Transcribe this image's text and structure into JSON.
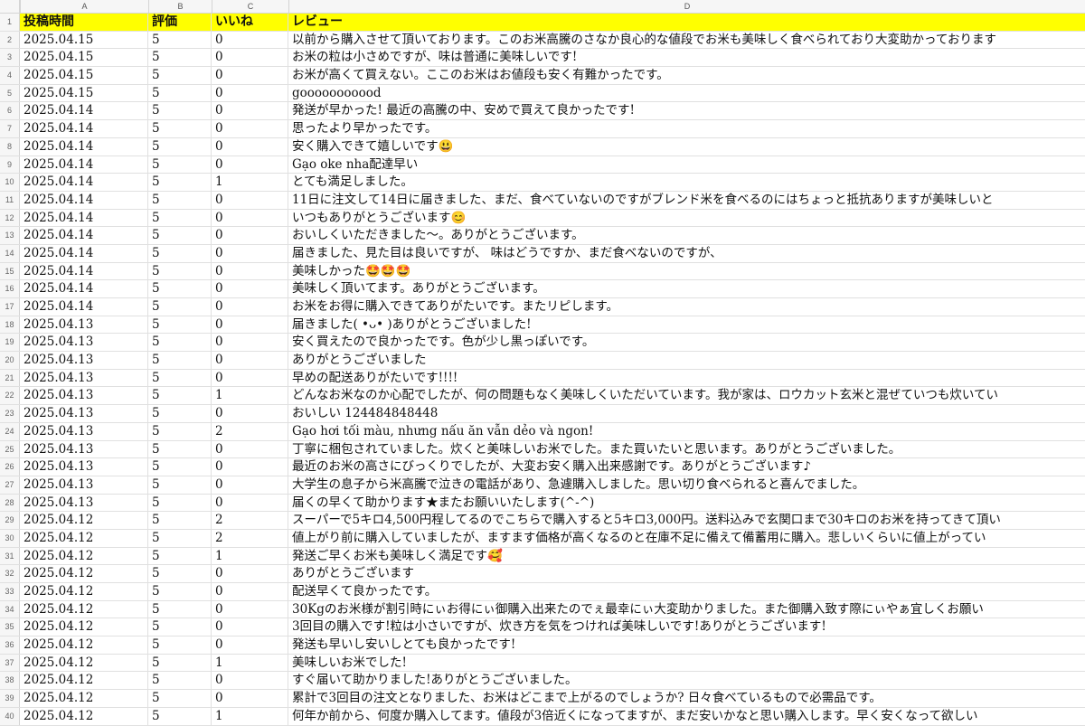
{
  "column_headers": [
    "A",
    "B",
    "C",
    "D"
  ],
  "header_row": {
    "row_num": "1",
    "a": "投稿時間",
    "b": "評価",
    "c": "いいね",
    "d": "レビュー"
  },
  "rows": [
    {
      "n": "2",
      "a": "2025.04.15",
      "b": "5",
      "c": "0",
      "d": "以前から購入させて頂いております。このお米高騰のさなか良心的な値段でお米も美味しく食べられており大変助かっております"
    },
    {
      "n": "3",
      "a": "2025.04.15",
      "b": "5",
      "c": "0",
      "d": "お米の粒は小さめですが、味は普通に美味しいです!"
    },
    {
      "n": "4",
      "a": "2025.04.15",
      "b": "5",
      "c": "0",
      "d": "お米が高くて買えない。ここのお米はお値段も安く有難かったです。"
    },
    {
      "n": "5",
      "a": "2025.04.15",
      "b": "5",
      "c": "0",
      "d": "gooooooooood"
    },
    {
      "n": "6",
      "a": "2025.04.14",
      "b": "5",
      "c": "0",
      "d": "発送が早かった! 最近の高騰の中、安めで買えて良かったです!"
    },
    {
      "n": "7",
      "a": "2025.04.14",
      "b": "5",
      "c": "0",
      "d": "思ったより早かったです。"
    },
    {
      "n": "8",
      "a": "2025.04.14",
      "b": "5",
      "c": "0",
      "d": "安く購入できて嬉しいです😃"
    },
    {
      "n": "9",
      "a": "2025.04.14",
      "b": "5",
      "c": "0",
      "d": "Gạo oke nha配達早い"
    },
    {
      "n": "10",
      "a": "2025.04.14",
      "b": "5",
      "c": "1",
      "d": "とても満足しました。"
    },
    {
      "n": "11",
      "a": "2025.04.14",
      "b": "5",
      "c": "0",
      "d": "11日に注文して14日に届きました、まだ、食べていないのですがブレンド米を食べるのにはちょっと抵抗ありますが美味しいと"
    },
    {
      "n": "12",
      "a": "2025.04.14",
      "b": "5",
      "c": "0",
      "d": "いつもありがとうございます😊"
    },
    {
      "n": "13",
      "a": "2025.04.14",
      "b": "5",
      "c": "0",
      "d": "おいしくいただきました〜。ありがとうございます。"
    },
    {
      "n": "14",
      "a": "2025.04.14",
      "b": "5",
      "c": "0",
      "d": "届きました、見た目は良いですが、 味はどうですか、まだ食べないのですが、"
    },
    {
      "n": "15",
      "a": "2025.04.14",
      "b": "5",
      "c": "0",
      "d": "美味しかった🤩🤩🤩"
    },
    {
      "n": "16",
      "a": "2025.04.14",
      "b": "5",
      "c": "0",
      "d": "美味しく頂いてます。ありがとうございます。"
    },
    {
      "n": "17",
      "a": "2025.04.14",
      "b": "5",
      "c": "0",
      "d": "お米をお得に購入できてありがたいです。またリピします。"
    },
    {
      "n": "18",
      "a": "2025.04.13",
      "b": "5",
      "c": "0",
      "d": "届きました( •ᴗ• )ありがとうございました!"
    },
    {
      "n": "19",
      "a": "2025.04.13",
      "b": "5",
      "c": "0",
      "d": "安く買えたので良かったです。色が少し黒っぽいです。"
    },
    {
      "n": "20",
      "a": "2025.04.13",
      "b": "5",
      "c": "0",
      "d": "ありがとうございました"
    },
    {
      "n": "21",
      "a": "2025.04.13",
      "b": "5",
      "c": "0",
      "d": "早めの配送ありがたいです!!!!"
    },
    {
      "n": "22",
      "a": "2025.04.13",
      "b": "5",
      "c": "1",
      "d": "どんなお米なのか心配でしたが、何の問題もなく美味しくいただいています。我が家は、ロウカット玄米と混ぜていつも炊いてい"
    },
    {
      "n": "23",
      "a": "2025.04.13",
      "b": "5",
      "c": "0",
      "d": "おいしい 124484848448"
    },
    {
      "n": "24",
      "a": "2025.04.13",
      "b": "5",
      "c": "2",
      "d": "Gạo hơi tối màu, nhưng nấu ăn vẫn dẻo và ngon!"
    },
    {
      "n": "25",
      "a": "2025.04.13",
      "b": "5",
      "c": "0",
      "d": "丁寧に梱包されていました。炊くと美味しいお米でした。また買いたいと思います。ありがとうございました。"
    },
    {
      "n": "26",
      "a": "2025.04.13",
      "b": "5",
      "c": "0",
      "d": "最近のお米の高さにびっくりでしたが、大変お安く購入出来感謝です。ありがとうございます♪"
    },
    {
      "n": "27",
      "a": "2025.04.13",
      "b": "5",
      "c": "0",
      "d": "大学生の息子から米高騰で泣きの電話があり、急遽購入しました。思い切り食べられると喜んでました。"
    },
    {
      "n": "28",
      "a": "2025.04.13",
      "b": "5",
      "c": "0",
      "d": "届くの早くて助かります★またお願いいたします(^-^)"
    },
    {
      "n": "29",
      "a": "2025.04.12",
      "b": "5",
      "c": "2",
      "d": "スーパーで5キロ4,500円程してるのでこちらで購入すると5キロ3,000円。送料込みで玄関口まで30キロのお米を持ってきて頂い"
    },
    {
      "n": "30",
      "a": "2025.04.12",
      "b": "5",
      "c": "2",
      "d": "値上がり前に購入していましたが、ますます価格が高くなるのと在庫不足に備えて備蓄用に購入。悲しいくらいに値上がってい"
    },
    {
      "n": "31",
      "a": "2025.04.12",
      "b": "5",
      "c": "1",
      "d": "発送ご早くお米も美味しく満足です🥰"
    },
    {
      "n": "32",
      "a": "2025.04.12",
      "b": "5",
      "c": "0",
      "d": "ありがとうございます"
    },
    {
      "n": "33",
      "a": "2025.04.12",
      "b": "5",
      "c": "0",
      "d": "配送早くて良かったです。"
    },
    {
      "n": "34",
      "a": "2025.04.12",
      "b": "5",
      "c": "0",
      "d": "30Kgのお米様が割引時にぃお得にぃ御購入出来たのでぇ最幸にぃ大変助かりました。また御購入致す際にぃやぁ宜しくお願い"
    },
    {
      "n": "35",
      "a": "2025.04.12",
      "b": "5",
      "c": "0",
      "d": "3回目の購入です!粒は小さいですが、炊き方を気をつければ美味しいです!ありがとうございます!"
    },
    {
      "n": "36",
      "a": "2025.04.12",
      "b": "5",
      "c": "0",
      "d": "発送も早いし安いしとても良かったです!"
    },
    {
      "n": "37",
      "a": "2025.04.12",
      "b": "5",
      "c": "1",
      "d": "美味しいお米でした!"
    },
    {
      "n": "38",
      "a": "2025.04.12",
      "b": "5",
      "c": "0",
      "d": "すぐ届いて助かりました!ありがとうございました。"
    },
    {
      "n": "39",
      "a": "2025.04.12",
      "b": "5",
      "c": "0",
      "d": "累計で3回目の注文となりました、お米はどこまで上がるのでしょうか? 日々食べているもので必需品です。"
    },
    {
      "n": "40",
      "a": "2025.04.12",
      "b": "5",
      "c": "1",
      "d": "何年か前から、何度か購入してます。値段が3倍近くになってますが、まだ安いかなと思い購入します。早く安くなって欲しい"
    }
  ]
}
